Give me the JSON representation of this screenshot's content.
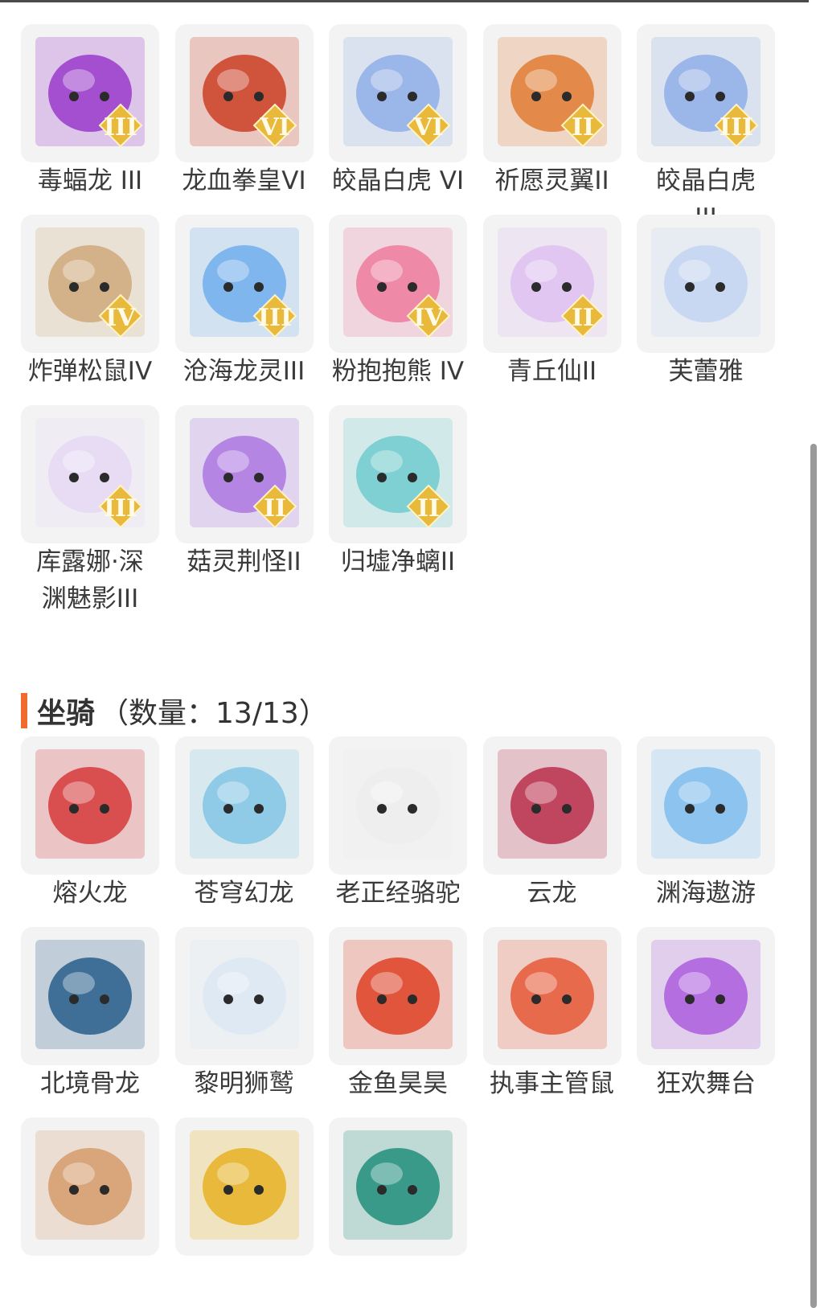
{
  "colors": {
    "accent": "#f06a2b",
    "tile_bg": "#f3f3f3",
    "badge": "#e8b93a"
  },
  "pets": [
    {
      "name": "毒蝠龙 III",
      "badge": "III",
      "icon": "purple-dragon-icon",
      "bg": "#a34fd0"
    },
    {
      "name": "龙血拳皇VI",
      "badge": "VI",
      "icon": "ram-warrior-icon",
      "bg": "#d0533c"
    },
    {
      "name": "皎晶白虎 VI",
      "badge": "VI",
      "icon": "white-tiger-icon",
      "bg": "#9bb6e8"
    },
    {
      "name": "祈愿灵翼II",
      "badge": "II",
      "icon": "eagle-icon",
      "bg": "#e38a4a"
    },
    {
      "name": "皎晶白虎 III",
      "badge": "III",
      "icon": "white-tiger-icon",
      "bg": "#9bb6e8"
    },
    {
      "name": "炸弹松鼠IV",
      "badge": "IV",
      "icon": "squirrel-icon",
      "bg": "#d3b28a"
    },
    {
      "name": "沧海龙灵III",
      "badge": "III",
      "icon": "blue-dragon-girl-icon",
      "bg": "#7fb6ee"
    },
    {
      "name": "粉抱抱熊 IV",
      "badge": "IV",
      "icon": "pink-bear-icon",
      "bg": "#ee8aa8"
    },
    {
      "name": "青丘仙II",
      "badge": "II",
      "icon": "fox-fairy-icon",
      "bg": "#e0c6f0"
    },
    {
      "name": "芙蕾雅",
      "badge": "",
      "icon": "golden-fairy-icon",
      "bg": "#c9d8f2"
    },
    {
      "name": "库露娜·深渊魅影III",
      "badge": "III",
      "icon": "white-hair-girl-icon",
      "bg": "#e7dcf4"
    },
    {
      "name": "菇灵荆怪II",
      "badge": "II",
      "icon": "purple-elf-icon",
      "bg": "#b585e3"
    },
    {
      "name": "归墟净螭II",
      "badge": "II",
      "icon": "cyan-dragon-icon",
      "bg": "#7fd0d2"
    }
  ],
  "mounts_section": {
    "title": "坐骑",
    "count": "（数量：13/13）"
  },
  "mounts": [
    {
      "name": "熔火龙",
      "icon": "red-dragon-icon",
      "bg": "#d94f4f"
    },
    {
      "name": "苍穹幻龙",
      "icon": "sky-dragon-icon",
      "bg": "#8fcbe6"
    },
    {
      "name": "老正经骆驼",
      "icon": "camel-sunglasses-icon",
      "bg": "#eeeeee"
    },
    {
      "name": "云龙",
      "icon": "cloud-dragon-icon",
      "bg": "#c0455e"
    },
    {
      "name": "渊海遨游",
      "icon": "blue-dragon-girl-icon",
      "bg": "#8cc4ef"
    },
    {
      "name": "北境骨龙",
      "icon": "bone-dragon-icon",
      "bg": "#3f6f97"
    },
    {
      "name": "黎明狮鹫",
      "icon": "griffin-icon",
      "bg": "#dfe9f3"
    },
    {
      "name": "金鱼昊昊",
      "icon": "goldfish-icon",
      "bg": "#e0553c"
    },
    {
      "name": "执事主管鼠",
      "icon": "butler-mouse-icon",
      "bg": "#e86a4c"
    },
    {
      "name": "狂欢舞台",
      "icon": "heart-stage-icon",
      "bg": "#b56ee0"
    },
    {
      "name": "",
      "icon": "deer-icon",
      "bg": "#d9a57a"
    },
    {
      "name": "",
      "icon": "golden-throne-icon",
      "bg": "#e8b93a"
    },
    {
      "name": "",
      "icon": "jade-dragon-icon",
      "bg": "#3a9a8a"
    }
  ]
}
